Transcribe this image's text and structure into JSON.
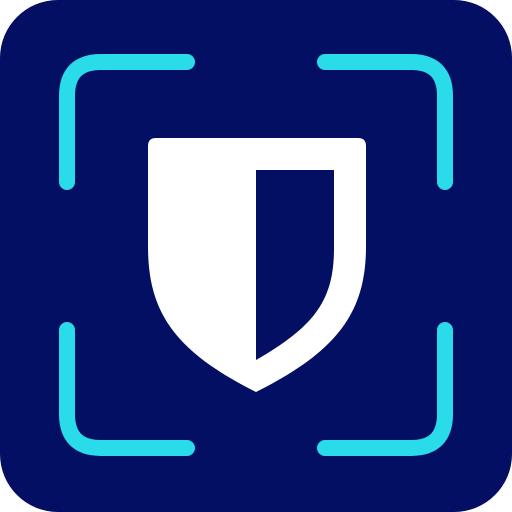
{
  "app_icon": {
    "background_color": "#020F63",
    "frame_color": "#2ADCE9",
    "shield_color": "#FFFFFF",
    "icon_names": {
      "frame": "scan-frame-icon",
      "shield": "shield-icon"
    }
  }
}
